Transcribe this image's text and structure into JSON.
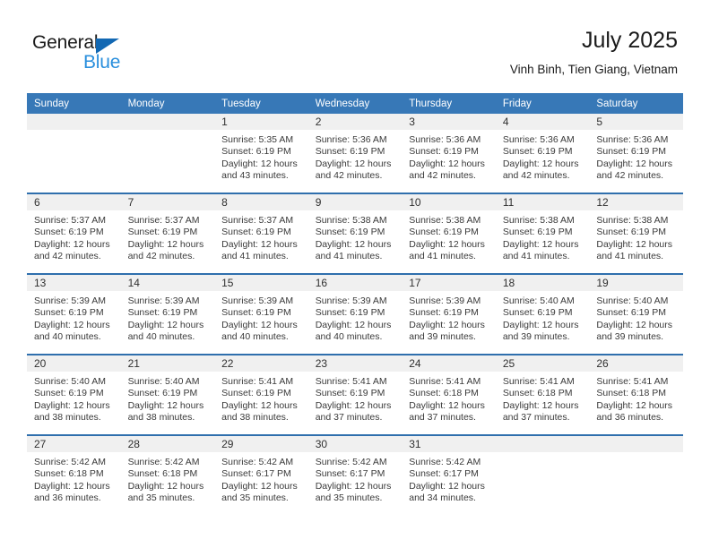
{
  "logo": {
    "text_primary": "General",
    "text_secondary": "Blue",
    "triangle_icon": "triangle-icon",
    "primary_color": "#1a1a1a",
    "secondary_color": "#2a8fdd",
    "triangle_color": "#1268b3"
  },
  "header": {
    "title": "July 2025",
    "subtitle": "Vinh Binh, Tien Giang, Vietnam"
  },
  "colors": {
    "header_row_bg": "#3778b7",
    "row_separator": "#2f6fad",
    "daynum_band_bg": "#f0f0f0",
    "cell_bg": "#ffffff",
    "text": "#3a3a3a"
  },
  "weekday_headers": [
    "Sunday",
    "Monday",
    "Tuesday",
    "Wednesday",
    "Thursday",
    "Friday",
    "Saturday"
  ],
  "weeks": [
    [
      {
        "day": "",
        "sunrise": "",
        "sunset": "",
        "daylight1": "",
        "daylight2": ""
      },
      {
        "day": "",
        "sunrise": "",
        "sunset": "",
        "daylight1": "",
        "daylight2": ""
      },
      {
        "day": "1",
        "sunrise": "Sunrise: 5:35 AM",
        "sunset": "Sunset: 6:19 PM",
        "daylight1": "Daylight: 12 hours",
        "daylight2": "and 43 minutes."
      },
      {
        "day": "2",
        "sunrise": "Sunrise: 5:36 AM",
        "sunset": "Sunset: 6:19 PM",
        "daylight1": "Daylight: 12 hours",
        "daylight2": "and 42 minutes."
      },
      {
        "day": "3",
        "sunrise": "Sunrise: 5:36 AM",
        "sunset": "Sunset: 6:19 PM",
        "daylight1": "Daylight: 12 hours",
        "daylight2": "and 42 minutes."
      },
      {
        "day": "4",
        "sunrise": "Sunrise: 5:36 AM",
        "sunset": "Sunset: 6:19 PM",
        "daylight1": "Daylight: 12 hours",
        "daylight2": "and 42 minutes."
      },
      {
        "day": "5",
        "sunrise": "Sunrise: 5:36 AM",
        "sunset": "Sunset: 6:19 PM",
        "daylight1": "Daylight: 12 hours",
        "daylight2": "and 42 minutes."
      }
    ],
    [
      {
        "day": "6",
        "sunrise": "Sunrise: 5:37 AM",
        "sunset": "Sunset: 6:19 PM",
        "daylight1": "Daylight: 12 hours",
        "daylight2": "and 42 minutes."
      },
      {
        "day": "7",
        "sunrise": "Sunrise: 5:37 AM",
        "sunset": "Sunset: 6:19 PM",
        "daylight1": "Daylight: 12 hours",
        "daylight2": "and 42 minutes."
      },
      {
        "day": "8",
        "sunrise": "Sunrise: 5:37 AM",
        "sunset": "Sunset: 6:19 PM",
        "daylight1": "Daylight: 12 hours",
        "daylight2": "and 41 minutes."
      },
      {
        "day": "9",
        "sunrise": "Sunrise: 5:38 AM",
        "sunset": "Sunset: 6:19 PM",
        "daylight1": "Daylight: 12 hours",
        "daylight2": "and 41 minutes."
      },
      {
        "day": "10",
        "sunrise": "Sunrise: 5:38 AM",
        "sunset": "Sunset: 6:19 PM",
        "daylight1": "Daylight: 12 hours",
        "daylight2": "and 41 minutes."
      },
      {
        "day": "11",
        "sunrise": "Sunrise: 5:38 AM",
        "sunset": "Sunset: 6:19 PM",
        "daylight1": "Daylight: 12 hours",
        "daylight2": "and 41 minutes."
      },
      {
        "day": "12",
        "sunrise": "Sunrise: 5:38 AM",
        "sunset": "Sunset: 6:19 PM",
        "daylight1": "Daylight: 12 hours",
        "daylight2": "and 41 minutes."
      }
    ],
    [
      {
        "day": "13",
        "sunrise": "Sunrise: 5:39 AM",
        "sunset": "Sunset: 6:19 PM",
        "daylight1": "Daylight: 12 hours",
        "daylight2": "and 40 minutes."
      },
      {
        "day": "14",
        "sunrise": "Sunrise: 5:39 AM",
        "sunset": "Sunset: 6:19 PM",
        "daylight1": "Daylight: 12 hours",
        "daylight2": "and 40 minutes."
      },
      {
        "day": "15",
        "sunrise": "Sunrise: 5:39 AM",
        "sunset": "Sunset: 6:19 PM",
        "daylight1": "Daylight: 12 hours",
        "daylight2": "and 40 minutes."
      },
      {
        "day": "16",
        "sunrise": "Sunrise: 5:39 AM",
        "sunset": "Sunset: 6:19 PM",
        "daylight1": "Daylight: 12 hours",
        "daylight2": "and 40 minutes."
      },
      {
        "day": "17",
        "sunrise": "Sunrise: 5:39 AM",
        "sunset": "Sunset: 6:19 PM",
        "daylight1": "Daylight: 12 hours",
        "daylight2": "and 39 minutes."
      },
      {
        "day": "18",
        "sunrise": "Sunrise: 5:40 AM",
        "sunset": "Sunset: 6:19 PM",
        "daylight1": "Daylight: 12 hours",
        "daylight2": "and 39 minutes."
      },
      {
        "day": "19",
        "sunrise": "Sunrise: 5:40 AM",
        "sunset": "Sunset: 6:19 PM",
        "daylight1": "Daylight: 12 hours",
        "daylight2": "and 39 minutes."
      }
    ],
    [
      {
        "day": "20",
        "sunrise": "Sunrise: 5:40 AM",
        "sunset": "Sunset: 6:19 PM",
        "daylight1": "Daylight: 12 hours",
        "daylight2": "and 38 minutes."
      },
      {
        "day": "21",
        "sunrise": "Sunrise: 5:40 AM",
        "sunset": "Sunset: 6:19 PM",
        "daylight1": "Daylight: 12 hours",
        "daylight2": "and 38 minutes."
      },
      {
        "day": "22",
        "sunrise": "Sunrise: 5:41 AM",
        "sunset": "Sunset: 6:19 PM",
        "daylight1": "Daylight: 12 hours",
        "daylight2": "and 38 minutes."
      },
      {
        "day": "23",
        "sunrise": "Sunrise: 5:41 AM",
        "sunset": "Sunset: 6:19 PM",
        "daylight1": "Daylight: 12 hours",
        "daylight2": "and 37 minutes."
      },
      {
        "day": "24",
        "sunrise": "Sunrise: 5:41 AM",
        "sunset": "Sunset: 6:18 PM",
        "daylight1": "Daylight: 12 hours",
        "daylight2": "and 37 minutes."
      },
      {
        "day": "25",
        "sunrise": "Sunrise: 5:41 AM",
        "sunset": "Sunset: 6:18 PM",
        "daylight1": "Daylight: 12 hours",
        "daylight2": "and 37 minutes."
      },
      {
        "day": "26",
        "sunrise": "Sunrise: 5:41 AM",
        "sunset": "Sunset: 6:18 PM",
        "daylight1": "Daylight: 12 hours",
        "daylight2": "and 36 minutes."
      }
    ],
    [
      {
        "day": "27",
        "sunrise": "Sunrise: 5:42 AM",
        "sunset": "Sunset: 6:18 PM",
        "daylight1": "Daylight: 12 hours",
        "daylight2": "and 36 minutes."
      },
      {
        "day": "28",
        "sunrise": "Sunrise: 5:42 AM",
        "sunset": "Sunset: 6:18 PM",
        "daylight1": "Daylight: 12 hours",
        "daylight2": "and 35 minutes."
      },
      {
        "day": "29",
        "sunrise": "Sunrise: 5:42 AM",
        "sunset": "Sunset: 6:17 PM",
        "daylight1": "Daylight: 12 hours",
        "daylight2": "and 35 minutes."
      },
      {
        "day": "30",
        "sunrise": "Sunrise: 5:42 AM",
        "sunset": "Sunset: 6:17 PM",
        "daylight1": "Daylight: 12 hours",
        "daylight2": "and 35 minutes."
      },
      {
        "day": "31",
        "sunrise": "Sunrise: 5:42 AM",
        "sunset": "Sunset: 6:17 PM",
        "daylight1": "Daylight: 12 hours",
        "daylight2": "and 34 minutes."
      },
      {
        "day": "",
        "sunrise": "",
        "sunset": "",
        "daylight1": "",
        "daylight2": ""
      },
      {
        "day": "",
        "sunrise": "",
        "sunset": "",
        "daylight1": "",
        "daylight2": ""
      }
    ]
  ]
}
